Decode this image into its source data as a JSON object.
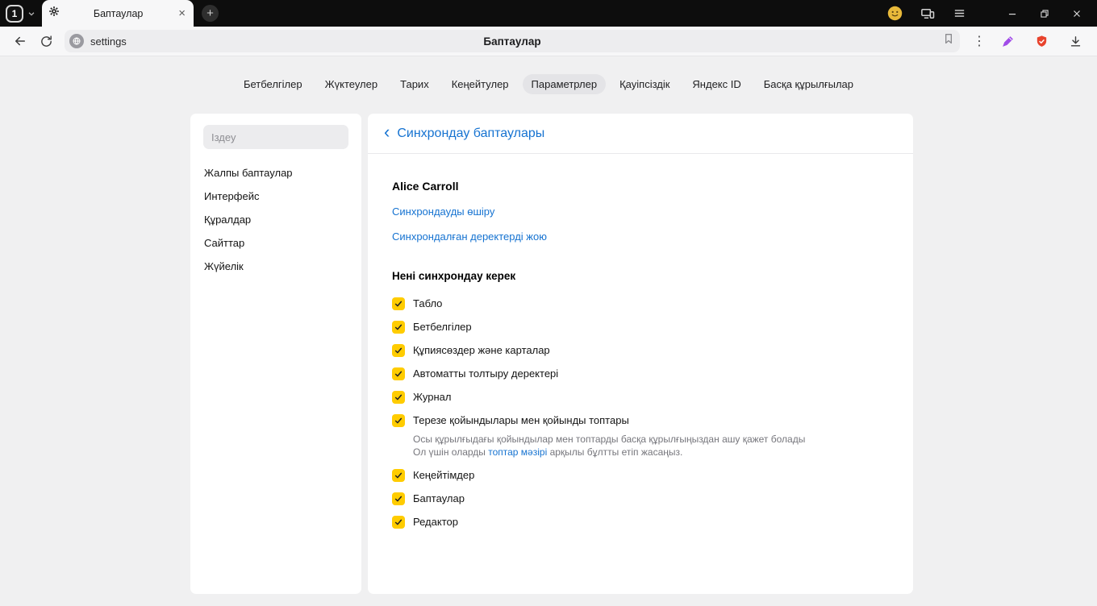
{
  "titlebar": {
    "tab_group_label": "1",
    "tab_title": "Баптаулар"
  },
  "toolbar": {
    "url": "settings",
    "page_title": "Баптаулар"
  },
  "icons": {
    "close_tab": "×",
    "new_tab": "+",
    "kebab": "⋮",
    "back_chevron": "‹"
  },
  "nav": {
    "items": [
      "Бетбелгілер",
      "Жүктеулер",
      "Тарих",
      "Кеңейтулер",
      "Параметрлер",
      "Қауіпсіздік",
      "Яндекс ID",
      "Басқа құрылғылар"
    ],
    "selected": "Параметрлер"
  },
  "sidebar": {
    "search_placeholder": "Іздеу",
    "items": [
      "Жалпы баптаулар",
      "Интерфейс",
      "Құралдар",
      "Сайттар",
      "Жүйелік"
    ]
  },
  "main": {
    "header": "Синхрондау баптаулары",
    "account_name": "Alice Carroll",
    "link_disable_sync": "Синхрондауды өшіру",
    "link_delete_data": "Синхрондалған деректерді жою",
    "section_title": "Нені синхрондау керек",
    "checkboxes": [
      {
        "label": "Табло",
        "checked": true
      },
      {
        "label": "Бетбелгілер",
        "checked": true
      },
      {
        "label": "Құпиясөздер және карталар",
        "checked": true
      },
      {
        "label": "Автоматты толтыру деректері",
        "checked": true
      },
      {
        "label": "Журнал",
        "checked": true
      },
      {
        "label": "Терезе қойындылары мен қойынды топтары",
        "checked": true,
        "desc_line1": "Осы құрылғыдағы қойындылар мен топтарды басқа құрылғыңыздан ашу қажет болады",
        "desc_line2_pre": "Ол үшін оларды ",
        "desc_line2_link": "топтар мәзірі",
        "desc_line2_post": " арқылы бұлтты етіп жасаңыз."
      },
      {
        "label": "Кеңейтімдер",
        "checked": true
      },
      {
        "label": "Баптаулар",
        "checked": true
      },
      {
        "label": "Редактор",
        "checked": true
      }
    ]
  },
  "colors": {
    "accent_blue": "#1673d1",
    "checkbox_yellow": "#ffcc00",
    "titlebar_bg": "#0d0d0d",
    "selected_pill": "#e4e4e7",
    "pen_icon_purple": "#a14ce8",
    "shield_icon_red": "#e8432d",
    "avatar_yellow": "#e8b93a"
  }
}
